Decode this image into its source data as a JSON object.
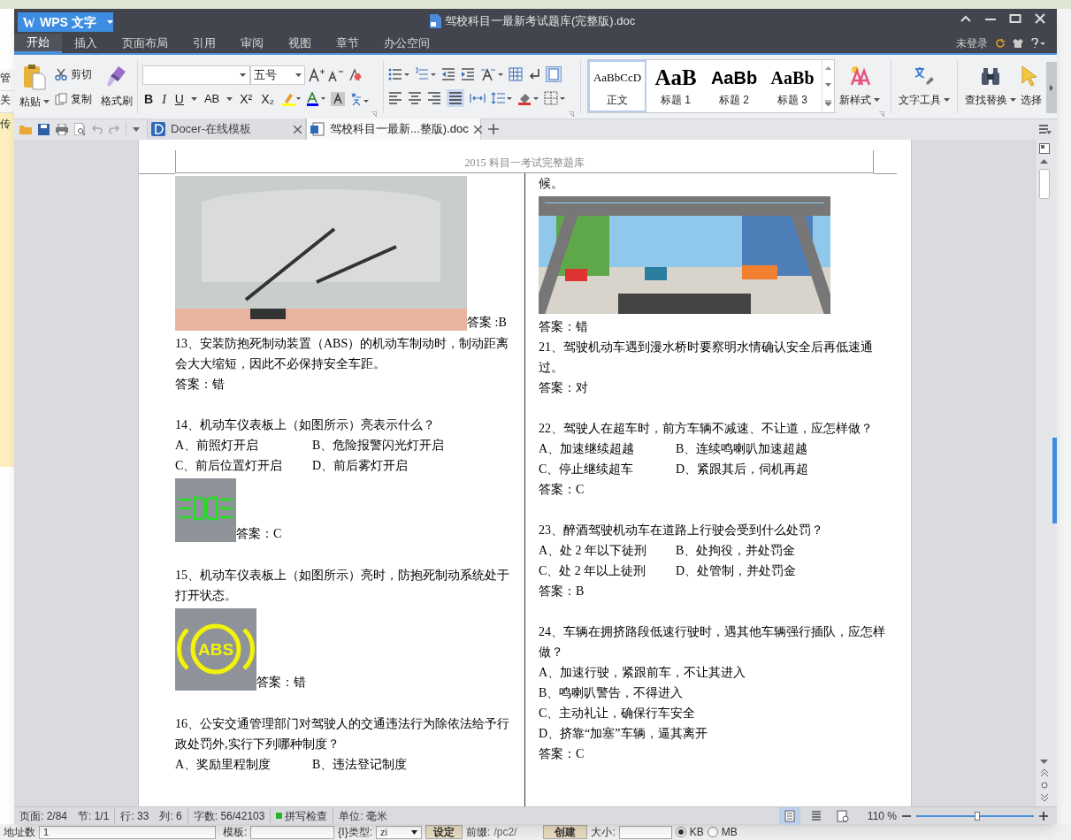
{
  "background": {
    "left_fragments": [
      "管",
      "关",
      "传"
    ],
    "bottom_bar": {
      "address_label": "地址数",
      "address_value": "1",
      "template_label": "模板:",
      "type_label": "{I}类型:",
      "type_value": "zi",
      "set_button": "设定",
      "prefix_label": "前缀:",
      "prefix_value": "/pc2/",
      "create_button": "创建",
      "size_label": "大小:",
      "units": [
        {
          "label": "KB",
          "selected": true
        },
        {
          "label": "MB",
          "selected": false
        }
      ]
    }
  },
  "window": {
    "app_button": "WPS 文字",
    "title": "驾校科目一最新考试题库(完整版).doc",
    "account": "未登录"
  },
  "menu_tabs": [
    {
      "label": "开始",
      "selected": true
    },
    {
      "label": "插入",
      "selected": false
    },
    {
      "label": "页面布局",
      "selected": false
    },
    {
      "label": "引用",
      "selected": false
    },
    {
      "label": "审阅",
      "selected": false
    },
    {
      "label": "视图",
      "selected": false
    },
    {
      "label": "章节",
      "selected": false
    },
    {
      "label": "办公空间",
      "selected": false
    }
  ],
  "ribbon": {
    "paste": "粘贴",
    "cut": "剪切",
    "copy": "复制",
    "format_painter": "格式刷",
    "font_size": "五号",
    "format_buttons": [
      "B",
      "I",
      "U",
      "AB",
      "X²",
      "X₂"
    ],
    "styles": [
      {
        "kind": "body",
        "preview": "AaBbCcD",
        "label": "正文",
        "selected": true
      },
      {
        "kind": "heading1",
        "preview": "AaB",
        "label": "标题 1",
        "selected": false
      },
      {
        "kind": "heading2",
        "preview": "AaBb",
        "label": "标题 2",
        "selected": false
      },
      {
        "kind": "heading3",
        "preview": "AaBb",
        "label": "标题 3",
        "selected": false
      }
    ],
    "new_style": "新样式",
    "text_tools": "文字工具",
    "find_replace": "查找替换",
    "select": "选择"
  },
  "doc_tabs": [
    {
      "label": "Docer-在线模板",
      "selected": false
    },
    {
      "label": "驾校科目一最新...整版).doc",
      "selected": true
    }
  ],
  "document": {
    "header": "2015 科目一考试完整题库",
    "left_column": [
      {
        "kind": "wiper-photo",
        "caption": "答案 :B"
      },
      {
        "kind": "para",
        "text": "13、安装防抱死制动装置（ABS）的机动车制动时，制动距离会大大缩短，因此不必保持安全车距。"
      },
      {
        "kind": "para",
        "text": "答案：错"
      },
      {
        "kind": "gap"
      },
      {
        "kind": "para",
        "text": "14、机动车仪表板上（如图所示）亮表示什么？"
      },
      {
        "kind": "options",
        "items": [
          "A、前照灯开启",
          "B、危险报警闪光灯开启"
        ]
      },
      {
        "kind": "options",
        "items": [
          "C、前后位置灯开启",
          "D、前后雾灯开启"
        ]
      },
      {
        "kind": "headlight-lamp",
        "caption": "答案：C"
      },
      {
        "kind": "gap"
      },
      {
        "kind": "para",
        "text": "15、机动车仪表板上（如图所示）亮时，防抱死制动系统处于打开状态。"
      },
      {
        "kind": "abs-lamp",
        "label": "ABS",
        "caption": "答案：错"
      },
      {
        "kind": "gap"
      },
      {
        "kind": "para",
        "text": "16、公安交通管理部门对驾驶人的交通违法行为除依法给予行政处罚外,实行下列哪种制度？"
      },
      {
        "kind": "options",
        "items": [
          "A、奖励里程制度",
          "B、违法登记制度"
        ]
      }
    ],
    "right_column": [
      {
        "kind": "para",
        "text": "候。"
      },
      {
        "kind": "road-photo"
      },
      {
        "kind": "para",
        "text": "答案：错"
      },
      {
        "kind": "para",
        "text": "21、驾驶机动车遇到漫水桥时要察明水情确认安全后再低速通过。"
      },
      {
        "kind": "para",
        "text": "答案：对"
      },
      {
        "kind": "gap"
      },
      {
        "kind": "para",
        "text": "22、驾驶人在超车时，前方车辆不减速、不让道，应怎样做？"
      },
      {
        "kind": "options",
        "items": [
          "A、加速继续超越",
          "B、连续鸣喇叭加速超越"
        ]
      },
      {
        "kind": "options",
        "items": [
          "C、停止继续超车",
          "D、紧跟其后，伺机再超"
        ]
      },
      {
        "kind": "para",
        "text": "答案：C"
      },
      {
        "kind": "gap"
      },
      {
        "kind": "para",
        "text": "23、醉酒驾驶机动车在道路上行驶会受到什么处罚？"
      },
      {
        "kind": "options",
        "items": [
          "A、处 2 年以下徒刑",
          "B、处拘役，并处罚金"
        ]
      },
      {
        "kind": "options",
        "items": [
          "C、处 2 年以上徒刑",
          "D、处管制，并处罚金"
        ]
      },
      {
        "kind": "para",
        "text": "答案：B"
      },
      {
        "kind": "gap"
      },
      {
        "kind": "para",
        "text": "24、车辆在拥挤路段低速行驶时，遇其他车辆强行插队，应怎样做？"
      },
      {
        "kind": "para",
        "text": "A、加速行驶，紧跟前车，不让其进入"
      },
      {
        "kind": "para",
        "text": "B、鸣喇叭警告，不得进入"
      },
      {
        "kind": "para",
        "text": "C、主动礼让，确保行车安全"
      },
      {
        "kind": "para",
        "text": "D、挤靠“加塞”车辆，逼其离开"
      },
      {
        "kind": "para",
        "text": "答案：C"
      }
    ]
  },
  "status_bar": {
    "fields": [
      "页面: 2/84",
      "节: 1/1",
      "行: 33",
      "列: 6",
      "字数: 56/42103"
    ],
    "spell_check": {
      "label": "拼写检查",
      "on": true
    },
    "unit": "单位: 毫米",
    "views": [
      {
        "kind": "page",
        "selected": true
      },
      {
        "kind": "outline",
        "selected": false
      },
      {
        "kind": "web",
        "selected": false
      }
    ],
    "zoom": "110 %",
    "zoom_slider": {
      "level": 0.52
    }
  }
}
